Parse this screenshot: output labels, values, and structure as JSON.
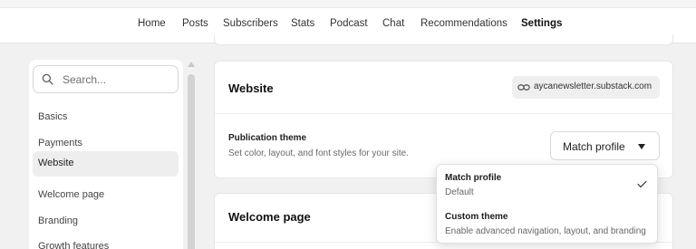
{
  "nav": {
    "items": [
      {
        "label": "Home"
      },
      {
        "label": "Posts"
      },
      {
        "label": "Subscribers"
      },
      {
        "label": "Stats"
      },
      {
        "label": "Podcast"
      },
      {
        "label": "Chat"
      },
      {
        "label": "Recommendations"
      },
      {
        "label": "Settings"
      }
    ],
    "active": "Settings"
  },
  "sidebar": {
    "search_placeholder": "Search...",
    "items": [
      {
        "label": "Basics"
      },
      {
        "label": "Payments"
      },
      {
        "label": "Website"
      },
      {
        "label": "Welcome page"
      },
      {
        "label": "Branding"
      },
      {
        "label": "Growth features"
      }
    ],
    "active": "Website"
  },
  "website_card": {
    "title": "Website",
    "url": "aycanewsletter.substack.com",
    "theme_label": "Publication theme",
    "theme_description": "Set color, layout, and font styles for your site.",
    "theme_selected": "Match profile"
  },
  "theme_dropdown": {
    "options": [
      {
        "title": "Match profile",
        "subtitle": "Default",
        "selected": true
      },
      {
        "title": "Custom theme",
        "subtitle": "Enable advanced navigation, layout, and branding",
        "selected": false
      }
    ]
  },
  "welcome_card": {
    "title": "Welcome page"
  },
  "icons": {
    "search": "search-icon",
    "link": "link-icon",
    "caret": "caret-down-icon",
    "check": "check-icon"
  }
}
